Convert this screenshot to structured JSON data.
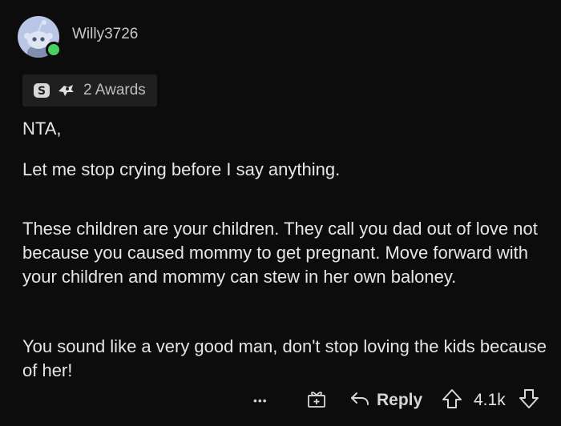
{
  "comment": {
    "username": "Willy3726",
    "awards_label": "2 Awards",
    "paragraphs": [
      "NTA,",
      "Let me stop crying before I say anything.",
      "These children are your children. They call you dad out of love not because you caused mommy to get pregnant. Move forward with your children and mommy can stew in her own baloney.",
      "You sound like a very good man, don't stop loving the kids because of her!"
    ]
  },
  "actions": {
    "more_label": "•••",
    "reply_label": "Reply",
    "score": "4.1k"
  },
  "icons": {
    "avatar": "snoo-avatar-icon",
    "award_1": "silver-award-icon",
    "award_2": "hand-award-icon",
    "gift": "gift-icon",
    "reply": "reply-arrow-icon",
    "upvote": "upvote-arrow-icon",
    "downvote": "downvote-arrow-icon"
  },
  "colors": {
    "background": "#0c0c0c",
    "online": "#46d160",
    "avatar_bg": "#b9c6e6",
    "text": "#e6e6e6"
  }
}
